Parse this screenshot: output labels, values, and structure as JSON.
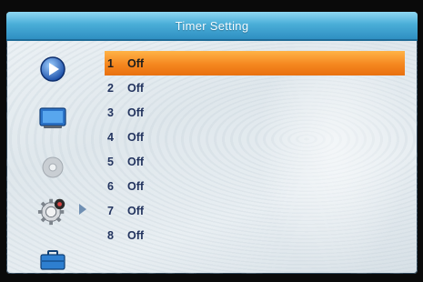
{
  "window": {
    "title": "Timer Setting"
  },
  "sidebar": {
    "items": [
      {
        "icon": "play-icon",
        "selected": false
      },
      {
        "icon": "monitor-icon",
        "selected": false
      },
      {
        "icon": "disc-icon",
        "selected": false
      },
      {
        "icon": "gear-icon",
        "selected": true
      },
      {
        "icon": "toolbox-icon",
        "selected": false
      }
    ]
  },
  "timers": [
    {
      "num": "1",
      "status": "Off",
      "selected": true
    },
    {
      "num": "2",
      "status": "Off",
      "selected": false
    },
    {
      "num": "3",
      "status": "Off",
      "selected": false
    },
    {
      "num": "4",
      "status": "Off",
      "selected": false
    },
    {
      "num": "5",
      "status": "Off",
      "selected": false
    },
    {
      "num": "6",
      "status": "Off",
      "selected": false
    },
    {
      "num": "7",
      "status": "Off",
      "selected": false
    },
    {
      "num": "8",
      "status": "Off",
      "selected": false
    }
  ],
  "colors": {
    "title_bar": "#3ea3d3",
    "highlight": "#f5871f",
    "text": "#23345f"
  }
}
